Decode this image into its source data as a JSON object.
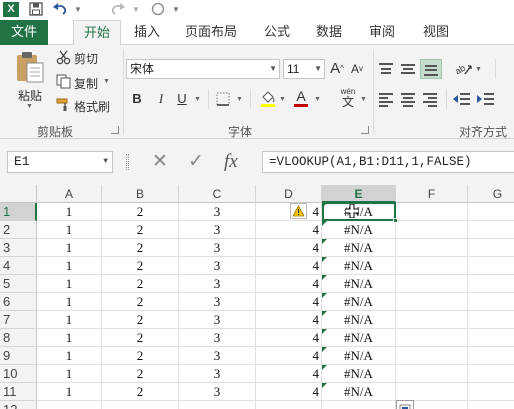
{
  "app": {
    "logo": "X"
  },
  "quick_access": {
    "save": "save-icon",
    "undo": "undo-icon",
    "redo": "redo-icon",
    "touch": "touch-mode-icon"
  },
  "tabs": [
    "文件",
    "开始",
    "插入",
    "页面布局",
    "公式",
    "数据",
    "审阅",
    "视图"
  ],
  "active_tab": "开始",
  "ribbon": {
    "clipboard": {
      "paste": "粘贴",
      "cut": "剪切",
      "copy": "复制",
      "format_painter": "格式刷",
      "group_label": "剪贴板"
    },
    "font": {
      "font_name": "宋体",
      "font_size": "11",
      "increase": "A",
      "decrease": "A",
      "bold": "B",
      "italic": "I",
      "underline": "U",
      "font_color_letter": "A",
      "phonetic_top": "wén",
      "phonetic_bottom": "文",
      "group_label": "字体",
      "accent_fill": "#ffff00",
      "accent_font": "#c00000"
    },
    "alignment": {
      "group_label": "对齐方式"
    }
  },
  "formula_bar": {
    "name_box": "E1",
    "cancel": "✕",
    "enter": "✓",
    "fx": "fx",
    "formula": "=VLOOKUP(A1,B1:D11,1,FALSE)"
  },
  "sheet": {
    "columns": [
      "A",
      "B",
      "C",
      "D",
      "E",
      "F",
      "G"
    ],
    "selected_column": "E",
    "selected_row": "1",
    "row_numbers": [
      "1",
      "2",
      "3",
      "4",
      "5",
      "6",
      "7",
      "8",
      "9",
      "10",
      "11",
      "12"
    ],
    "rows": [
      [
        "1",
        "2",
        "3",
        "4",
        "#N/A"
      ],
      [
        "1",
        "2",
        "3",
        "4",
        "#N/A"
      ],
      [
        "1",
        "2",
        "3",
        "4",
        "#N/A"
      ],
      [
        "1",
        "2",
        "3",
        "4",
        "#N/A"
      ],
      [
        "1",
        "2",
        "3",
        "4",
        "#N/A"
      ],
      [
        "1",
        "2",
        "3",
        "4",
        "#N/A"
      ],
      [
        "1",
        "2",
        "3",
        "4",
        "#N/A"
      ],
      [
        "1",
        "2",
        "3",
        "4",
        "#N/A"
      ],
      [
        "1",
        "2",
        "3",
        "4",
        "#N/A"
      ],
      [
        "1",
        "2",
        "3",
        "4",
        "#N/A"
      ],
      [
        "1",
        "2",
        "3",
        "4",
        "#N/A"
      ]
    ],
    "accent_color": "#217346"
  }
}
